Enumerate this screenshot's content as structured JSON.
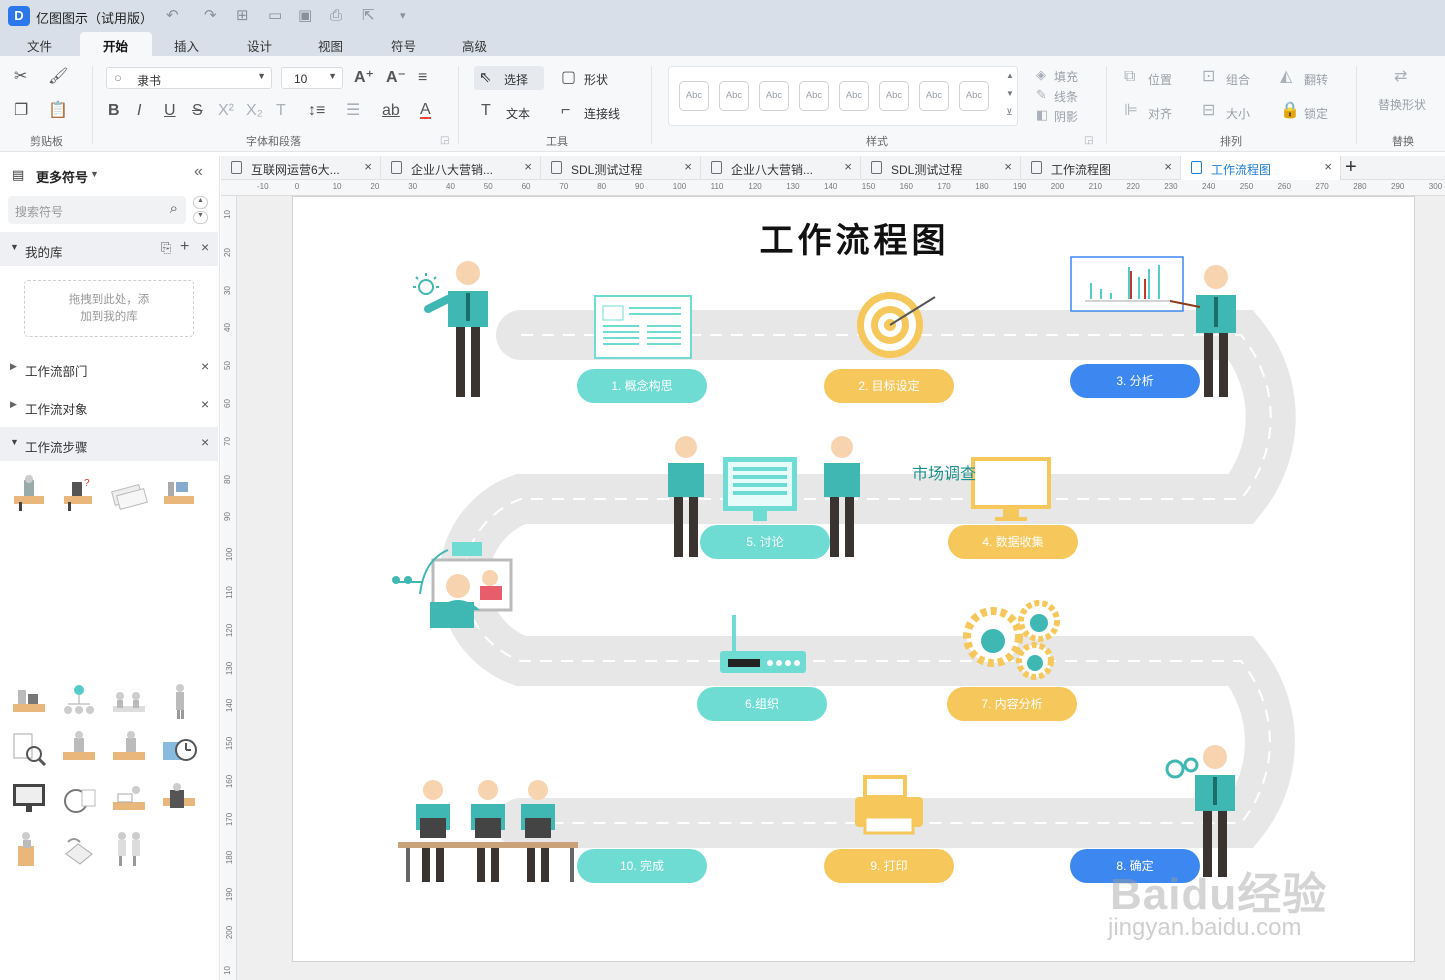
{
  "app": {
    "title": "亿图图示（试用版）"
  },
  "menu": {
    "items": [
      "文件",
      "开始",
      "插入",
      "设计",
      "视图",
      "符号",
      "高级"
    ],
    "active": "开始"
  },
  "ribbon": {
    "font_name": "隶书",
    "font_size": "10",
    "tools": {
      "select": "选择",
      "shape": "形状",
      "text": "文本",
      "connector": "连接线"
    },
    "style": {
      "abc_label": "Abc",
      "fill": "填充",
      "line": "线条",
      "shadow": "阴影"
    },
    "arrange": {
      "position": "位置",
      "group": "组合",
      "flip": "翻转",
      "align": "对齐",
      "size": "大小",
      "lock": "锁定"
    },
    "replace": {
      "label": "替换形状"
    },
    "groups": {
      "clipboard": "剪贴板",
      "font": "字体和段落",
      "tools": "工具",
      "styles": "样式",
      "arrange": "排列",
      "replace": "替换"
    }
  },
  "left_panel": {
    "header": "更多符号",
    "search_placeholder": "搜索符号",
    "my_library": "我的库",
    "drop_hint": "拖拽到此处，添\n加到我的库",
    "categories": [
      "工作流部门",
      "工作流对象",
      "工作流步骤"
    ]
  },
  "tabs": [
    {
      "label": "互联网运营6大...",
      "active": false
    },
    {
      "label": "企业八大营销...",
      "active": false
    },
    {
      "label": "SDL测试过程",
      "active": false
    },
    {
      "label": "企业八大营销...",
      "active": false
    },
    {
      "label": "SDL测试过程",
      "active": false
    },
    {
      "label": "工作流程图",
      "active": false
    },
    {
      "label": "工作流程图",
      "active": true
    }
  ],
  "ruler": {
    "h": [
      "-10",
      "0",
      "10",
      "20",
      "30",
      "40",
      "50",
      "60",
      "70",
      "80",
      "90",
      "100",
      "110",
      "120",
      "130",
      "140",
      "150",
      "160",
      "170",
      "180",
      "190",
      "200",
      "210",
      "220",
      "230",
      "240",
      "250",
      "260",
      "270",
      "280",
      "290",
      "300"
    ],
    "v": [
      "10",
      "20",
      "30",
      "40",
      "50",
      "60",
      "70",
      "80",
      "90",
      "100",
      "110",
      "120",
      "130",
      "140",
      "150",
      "160",
      "170",
      "180",
      "190",
      "200",
      "10"
    ]
  },
  "diagram": {
    "title": "工作流程图",
    "steps": [
      "1. 概念构思",
      "2. 目标设定",
      "3. 分析",
      "4. 数据收集",
      "5. 讨论",
      "6.组织",
      "7. 内容分析",
      "8. 确定",
      "9. 打印",
      "10. 完成"
    ],
    "annotation": "市场调查",
    "colors": {
      "teal": "#6fdcd4",
      "yellow": "#f6c75a",
      "blue": "#3d87f0",
      "road": "#e8e8e8",
      "person_shirt": "#3fb8b3",
      "skin": "#f8d3b0"
    }
  },
  "watermark": {
    "brand": "Baidu经验",
    "url": "jingyan.baidu.com"
  }
}
